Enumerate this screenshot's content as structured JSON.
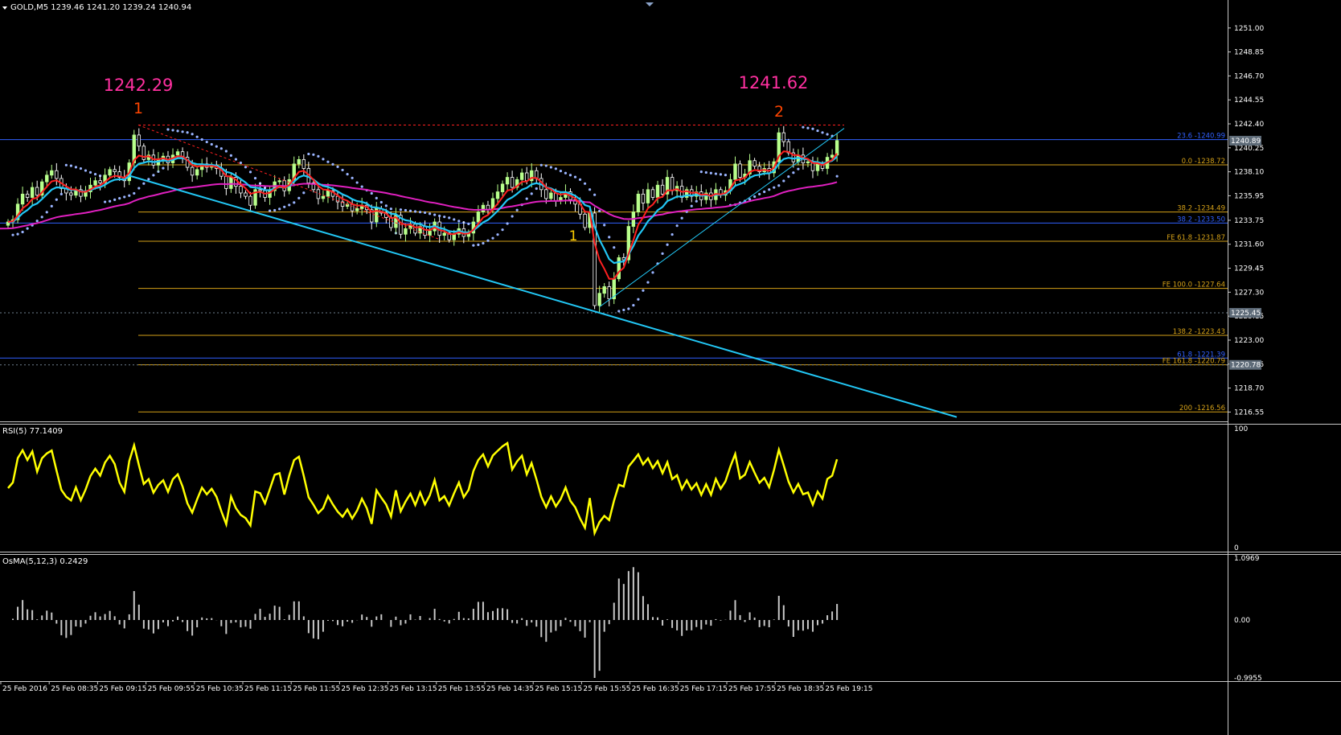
{
  "header": {
    "symbol_line": "GOLD,M5  1239.46 1241.20 1239.24 1240.94",
    "rsi_label": "RSI(5) 77.1409",
    "osma_label": "OsMA(5,12,3) 0.2429"
  },
  "annotations": {
    "peak1_price": "1242.29",
    "peak1_num": "1",
    "peak2_price": "1241.62",
    "peak2_num": "2",
    "low_num": "1"
  },
  "colors": {
    "bg": "#000000",
    "bull": "#b8ff8c",
    "bear": "#ffffff",
    "ema_fast": "#ff2020",
    "ema_slow": "#22c7f5",
    "ma_long": "#e020c0",
    "sar": "#9ab4ff",
    "trend": "#22c7f5",
    "fib": "#d4a017",
    "blue_level": "#3060ff",
    "rsi": "#ffff00",
    "osma": "#c8c8c8",
    "peak_price": "#ff30a0",
    "peak_num": "#ff4500",
    "low_num": "#ffd000"
  },
  "chart_data": {
    "type": "candlestick",
    "symbol": "GOLD",
    "timeframe": "M5",
    "price_axis": {
      "ticks": [
        "1251.00",
        "1248.85",
        "1246.70",
        "1244.55",
        "1242.40",
        "1240.25",
        "1238.10",
        "1235.95",
        "1233.75",
        "1231.60",
        "1229.45",
        "1227.30",
        "1225.15",
        "1223.00",
        "1220.85",
        "1218.70",
        "1216.55"
      ],
      "range": [
        1216.0,
        1252.5
      ]
    },
    "time_axis": {
      "labels": [
        "25 Feb 2016",
        "25 Feb 08:35",
        "25 Feb 09:15",
        "25 Feb 09:55",
        "25 Feb 10:35",
        "25 Feb 11:15",
        "25 Feb 11:55",
        "25 Feb 12:35",
        "25 Feb 13:15",
        "25 Feb 13:55",
        "25 Feb 14:35",
        "25 Feb 15:15",
        "25 Feb 15:55",
        "25 Feb 16:35",
        "25 Feb 17:15",
        "25 Feb 17:55",
        "25 Feb 18:35",
        "25 Feb 19:15"
      ]
    },
    "levels": [
      {
        "label": "23.6 -1240.99",
        "price": 1240.99,
        "kind": "blue",
        "dashed": false
      },
      {
        "label": "0.0 -1238.72",
        "price": 1238.72,
        "kind": "fib"
      },
      {
        "label": "38.2 -1234.49",
        "price": 1234.49,
        "kind": "fib"
      },
      {
        "label": "38.2 -1233.50",
        "price": 1233.5,
        "kind": "blue"
      },
      {
        "label": "FE 61.8 -1231.87",
        "price": 1231.87,
        "kind": "fib"
      },
      {
        "label": "FE 100.0 -1227.64",
        "price": 1227.64,
        "kind": "fib"
      },
      {
        "label": "138.2 -1223.43",
        "price": 1223.43,
        "kind": "fib"
      },
      {
        "label": "61.8 -1221.39",
        "price": 1221.39,
        "kind": "blue"
      },
      {
        "label": "FE 161.8 -1220.79",
        "price": 1220.79,
        "kind": "fib"
      },
      {
        "label": "200 -1216.56",
        "price": 1216.56,
        "kind": "fib"
      }
    ],
    "price_tags": [
      "1240.89",
      "1225.45",
      "1220.78"
    ],
    "price_tag_values": [
      1240.89,
      1225.45,
      1220.78
    ],
    "rsi_axis": {
      "ticks": [
        "100",
        "0"
      ]
    },
    "osma_axis": {
      "ticks": [
        "1.0969",
        "0.00",
        "-0.9955"
      ]
    },
    "close": [
      1233.6,
      1233.8,
      1235.2,
      1236.1,
      1235.8,
      1236.7,
      1236.0,
      1237.2,
      1237.8,
      1238.2,
      1237.5,
      1236.6,
      1236.2,
      1236.0,
      1236.5,
      1235.9,
      1236.3,
      1236.9,
      1237.3,
      1237.1,
      1237.8,
      1238.3,
      1238.1,
      1237.6,
      1237.3,
      1238.9,
      1241.4,
      1240.4,
      1239.2,
      1239.6,
      1238.7,
      1239.2,
      1239.5,
      1238.9,
      1239.6,
      1239.9,
      1239.4,
      1238.5,
      1237.8,
      1238.3,
      1238.8,
      1238.5,
      1238.7,
      1238.4,
      1237.7,
      1236.6,
      1237.6,
      1236.8,
      1236.2,
      1235.9,
      1235.1,
      1236.5,
      1236.4,
      1235.8,
      1236.4,
      1237.2,
      1237.3,
      1236.4,
      1237.4,
      1238.8,
      1239.2,
      1238.4,
      1237.1,
      1236.5,
      1235.7,
      1235.9,
      1236.4,
      1235.9,
      1235.4,
      1235.0,
      1235.2,
      1234.6,
      1234.8,
      1235.1,
      1234.7,
      1233.6,
      1234.8,
      1234.4,
      1234.0,
      1233.1,
      1234.2,
      1232.5,
      1233.0,
      1233.4,
      1232.6,
      1233.2,
      1232.4,
      1232.8,
      1233.6,
      1232.4,
      1232.6,
      1232.0,
      1232.5,
      1233.0,
      1232.3,
      1232.6,
      1233.6,
      1234.5,
      1235.1,
      1234.7,
      1235.7,
      1236.3,
      1237.0,
      1237.6,
      1236.7,
      1237.4,
      1238.0,
      1237.3,
      1238.2,
      1237.5,
      1236.5,
      1235.7,
      1236.2,
      1235.5,
      1235.8,
      1236.3,
      1235.6,
      1235.2,
      1234.3,
      1233.1,
      1234.4,
      1226.1,
      1227.2,
      1227.8,
      1226.7,
      1228.5,
      1230.4,
      1230.2,
      1233.2,
      1234.5,
      1236.1,
      1235.3,
      1236.5,
      1235.8,
      1236.9,
      1236.1,
      1237.6,
      1236.4,
      1236.8,
      1235.8,
      1236.5,
      1235.9,
      1236.3,
      1235.6,
      1236.2,
      1235.6,
      1236.5,
      1236.0,
      1236.4,
      1237.4,
      1238.8,
      1237.6,
      1237.9,
      1239.1,
      1238.6,
      1238.1,
      1238.4,
      1238.0,
      1239.0,
      1241.6,
      1240.8,
      1239.8,
      1239.0,
      1239.6,
      1238.9,
      1239.0,
      1238.2,
      1238.8,
      1238.4,
      1239.4,
      1239.6,
      1240.9
    ]
  }
}
